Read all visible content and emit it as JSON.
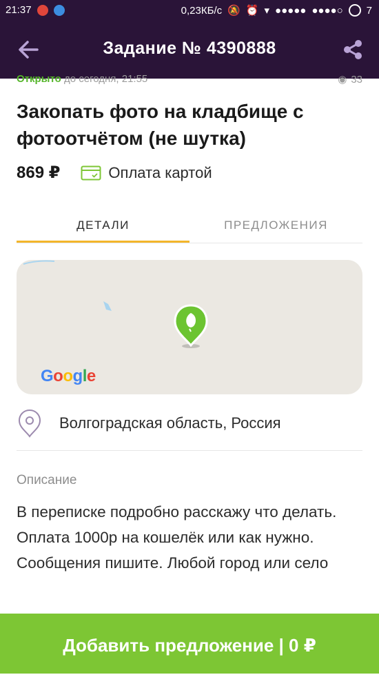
{
  "status_bar": {
    "time": "21:37",
    "network_speed": "0,23КБ/с",
    "battery": "7"
  },
  "header": {
    "title": "Задание № 4390888",
    "back_icon": "arrow-left-icon",
    "share_icon": "share-icon",
    "background": "#2a1438"
  },
  "task": {
    "status_text": "Открыто",
    "deadline_text": "до сегодня, 21:55",
    "views": "33",
    "title": "Закопать фото на кладбище с фотоотчётом (не шутка)",
    "price": "869 ₽",
    "payment_method": "Оплата картой"
  },
  "tabs": [
    {
      "label": "ДЕТАЛИ",
      "active": true
    },
    {
      "label": "ПРЕДЛОЖЕНИЯ",
      "active": false
    }
  ],
  "map": {
    "provider_logo": "Google",
    "pin_icon": "location-pin-icon",
    "pin_color": "#6cc431"
  },
  "location": {
    "text": "Волгоградская область, Россия"
  },
  "description": {
    "label": "Описание",
    "text": "В переписке подробно расскажу что делать. Оплата 1000р на кошелёк или как нужно. Сообщения пишите. Любой город или село"
  },
  "cta": {
    "label": "Добавить предложение | 0 ₽",
    "color": "#7dc634"
  },
  "colors": {
    "accent_tab": "#f3b62a",
    "status_green": "#55b52a"
  }
}
